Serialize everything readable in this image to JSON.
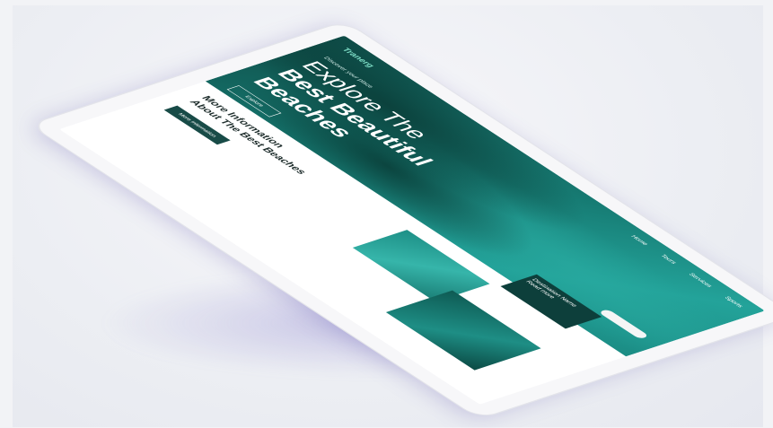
{
  "nav": {
    "logo": "Tranerg",
    "links": [
      "Home",
      "Tours",
      "Services",
      "Sports"
    ]
  },
  "hero": {
    "kicker": "Discover your place",
    "title_line1": "Explore The",
    "title_line2": "Best Beautiful",
    "title_line3": "Beaches",
    "button": "Explore"
  },
  "feature_card": {
    "title": "Destination Name",
    "subtitle": "Read more"
  },
  "info": {
    "title_line1": "More Information",
    "title_line2": "About The Best Beaches",
    "text": "",
    "button": "More Information"
  },
  "colors": {
    "accent": "#184b47",
    "sea": "#1b8c84",
    "logo": "#7fe0c8"
  }
}
